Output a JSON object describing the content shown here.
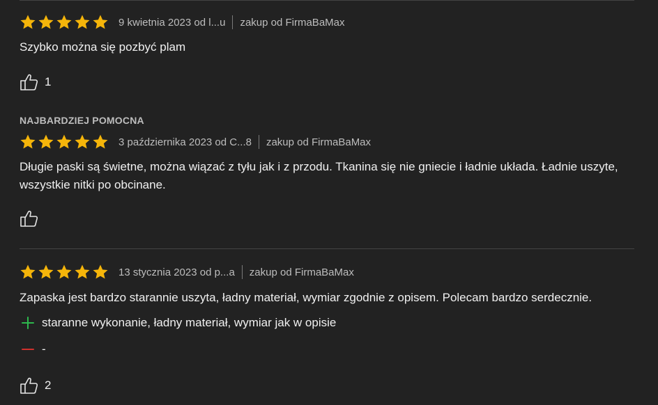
{
  "colors": {
    "background": "#222222",
    "star": "#f5b50a",
    "pro": "#2db84d",
    "con": "#d0312d",
    "text": "#f0f0f0",
    "meta_text": "#bdbdbd"
  },
  "reviews": [
    {
      "rating": 5,
      "date_author": "9 kwietnia 2023 od l...u",
      "vendor": "zakup od FirmaBaMax",
      "text": "Szybko można się pozbyć plam",
      "helpful_count": "1"
    },
    {
      "badge": "NAJBARDZIEJ POMOCNA",
      "rating": 5,
      "date_author": "3 października 2023 od C...8",
      "vendor": "zakup od FirmaBaMax",
      "text": "Długie paski są świetne, można wiązać z tyłu jak i z przodu. Tkanina się nie gniecie i ładnie układa. Ładnie uszyte, wszystkie nitki po obcinane.",
      "helpful_count": ""
    },
    {
      "rating": 5,
      "date_author": "13 stycznia 2023 od p...a",
      "vendor": "zakup od FirmaBaMax",
      "text": "Zapaska jest bardzo starannie uszyta, ładny materiał, wymiar zgodnie z opisem. Polecam bardzo serdecznie.",
      "pros": "staranne wykonanie, ładny materiał, wymiar jak w opisie",
      "cons": "-",
      "helpful_count": "2"
    }
  ],
  "icons": {
    "star": "star-icon",
    "thumb": "thumbs-up-icon",
    "plus": "plus-icon",
    "minus": "minus-icon"
  }
}
